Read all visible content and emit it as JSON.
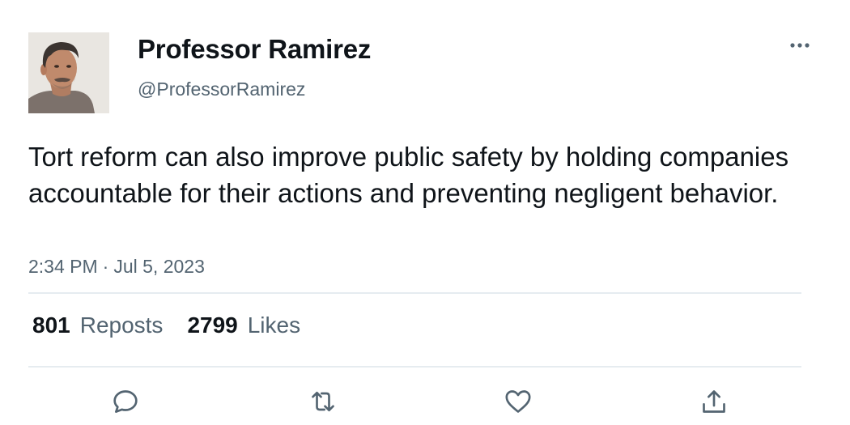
{
  "author": {
    "display_name": "Professor Ramirez",
    "handle": "@ProfessorRamirez",
    "avatar_icon": "person-portrait"
  },
  "tweet": {
    "text": "Tort reform can also improve public safety by holding companies accountable for their actions and preventing negligent behavior.",
    "time": "2:34 PM",
    "separator": "·",
    "date": "Jul 5, 2023"
  },
  "stats": {
    "reposts_count": "801",
    "reposts_label": "Reposts",
    "likes_count": "2799",
    "likes_label": "Likes"
  },
  "actions": {
    "reply_icon": "reply-icon",
    "repost_icon": "repost-icon",
    "like_icon": "heart-icon",
    "share_icon": "share-icon"
  },
  "colors": {
    "text_primary": "#0f1419",
    "text_secondary": "#536471",
    "divider": "#e6ecf0"
  }
}
